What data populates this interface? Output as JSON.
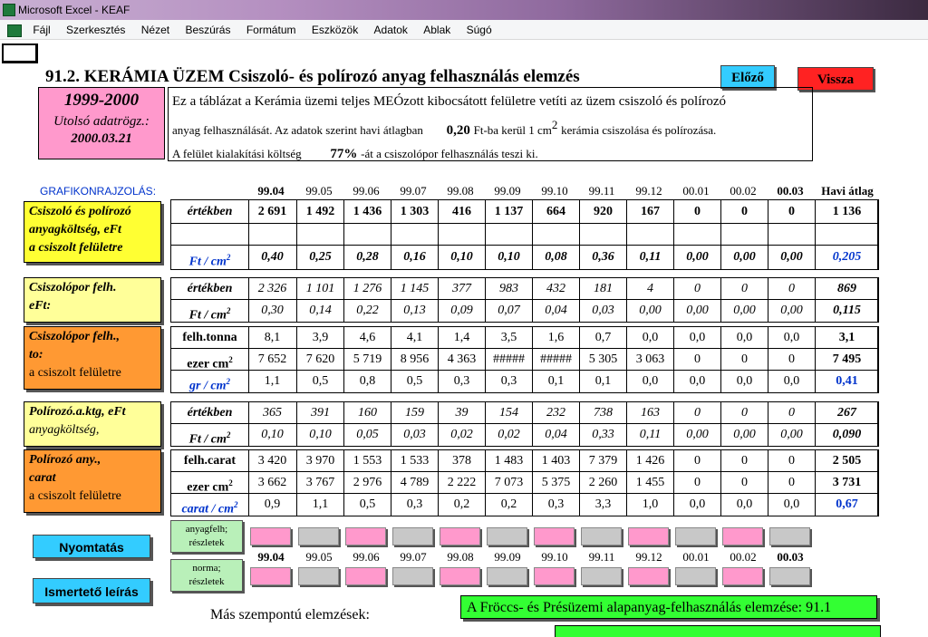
{
  "window": {
    "title": "Microsoft Excel - KEAF"
  },
  "menu": [
    "Fájl",
    "Szerkesztés",
    "Nézet",
    "Beszúrás",
    "Formátum",
    "Eszközök",
    "Adatok",
    "Ablak",
    "Súgó"
  ],
  "sheet": {
    "title": "91.2. KERÁMIA ÜZEM Csiszoló- és polírozó anyag felhasználás elemzés",
    "btn_prev": "Előző",
    "btn_back": "Vissza",
    "period": {
      "years": "1999-2000",
      "label": "Utolsó adatrögz.:",
      "date": "2000.03.21"
    },
    "desc": {
      "line1": "Ez a táblázat a Kerámia üzemi teljes MEÓzott kibocsátott felületre vetíti az üzem csiszoló és polírozó",
      "line2_a": "anyag felhasználását. Az adatok szerint havi átlagban",
      "line2_val": "0,20",
      "line2_b": "Ft-ba kerül 1 cm",
      "line2_sup": "2",
      "line2_c": "kerámia csiszolása és polírozása.",
      "line3_a": "A felület kialakítási költség",
      "line3_val": "77%",
      "line3_b": "-át a csiszolópor felhasználás teszi ki."
    },
    "grafikon": "GRAFIKONRAJZOLÁS:",
    "months": [
      "99.04",
      "99.05",
      "99.06",
      "99.07",
      "99.08",
      "99.09",
      "99.10",
      "99.11",
      "99.12",
      "00.01",
      "00.02",
      "00.03"
    ],
    "avg_header": "Havi átlag",
    "sections": [
      {
        "label_lines": [
          "Csiszoló és polírozó",
          "anyagköltség, eFt",
          "a csiszolt felületre"
        ],
        "rows": [
          {
            "unit": "értékben",
            "vals": [
              "2 691",
              "1 492",
              "1 436",
              "1 303",
              "416",
              "1 137",
              "664",
              "920",
              "167",
              "0",
              "0",
              "0"
            ],
            "avg": "1 136",
            "style": "bd"
          },
          {
            "unit": "",
            "vals": [
              "",
              "",
              "",
              "",
              "",
              "",
              "",
              "",
              "",
              "",
              "",
              ""
            ],
            "avg": "",
            "style": ""
          },
          {
            "unit": "Ft / cm",
            "sup": "2",
            "vals": [
              "0,40",
              "0,25",
              "0,28",
              "0,16",
              "0,10",
              "0,10",
              "0,08",
              "0,36",
              "0,11",
              "0,00",
              "0,00",
              "0,00"
            ],
            "avg": "0,205",
            "style": "bd it",
            "unit_blue": true,
            "avg_blue": true
          }
        ]
      },
      {
        "label_lines": [
          "Csiszolópor felh.",
          "eFt:"
        ],
        "rows": [
          {
            "unit": "értékben",
            "vals": [
              "2 326",
              "1 101",
              "1 276",
              "1 145",
              "377",
              "983",
              "432",
              "181",
              "4",
              "0",
              "0",
              "0"
            ],
            "avg": "869",
            "style": "it"
          },
          {
            "unit": "Ft / cm",
            "sup": "2",
            "vals": [
              "0,30",
              "0,14",
              "0,22",
              "0,13",
              "0,09",
              "0,07",
              "0,04",
              "0,03",
              "0,00",
              "0,00",
              "0,00",
              "0,00"
            ],
            "avg": "0,115",
            "style": "it"
          }
        ]
      },
      {
        "label_lines": [
          "Csiszolópor felh.,",
          "to:",
          "a csiszolt felületre"
        ],
        "rows": [
          {
            "unit": "felh.tonna",
            "vals": [
              "8,1",
              "3,9",
              "4,6",
              "4,1",
              "1,4",
              "3,5",
              "1,6",
              "0,7",
              "0,0",
              "0,0",
              "0,0",
              "0,0"
            ],
            "avg": "3,1",
            "style": ""
          },
          {
            "unit": "ezer cm",
            "sup": "2",
            "vals": [
              "7 652",
              "7 620",
              "5 719",
              "8 956",
              "4 363",
              "#####",
              "#####",
              "5 305",
              "3 063",
              "0",
              "0",
              "0"
            ],
            "avg": "7 495",
            "style": ""
          },
          {
            "unit": "gr / cm",
            "sup": "2",
            "vals": [
              "1,1",
              "0,5",
              "0,8",
              "0,5",
              "0,3",
              "0,3",
              "0,1",
              "0,1",
              "0,0",
              "0,0",
              "0,0",
              "0,0"
            ],
            "avg": "0,41",
            "style": "",
            "unit_blue": true,
            "avg_blue": true
          }
        ]
      },
      {
        "label_lines": [
          "Polírozó.a.ktg, eFt",
          "anyagköltség,"
        ],
        "rows": [
          {
            "unit": "értékben",
            "vals": [
              "365",
              "391",
              "160",
              "159",
              "39",
              "154",
              "232",
              "738",
              "163",
              "0",
              "0",
              "0"
            ],
            "avg": "267",
            "style": "it"
          },
          {
            "unit": "Ft / cm",
            "sup": "2",
            "vals": [
              "0,10",
              "0,10",
              "0,05",
              "0,03",
              "0,02",
              "0,02",
              "0,04",
              "0,33",
              "0,11",
              "0,00",
              "0,00",
              "0,00"
            ],
            "avg": "0,090",
            "style": "it"
          }
        ]
      },
      {
        "label_lines": [
          "Polírozó any.,",
          "carat",
          "a csiszolt felületre"
        ],
        "rows": [
          {
            "unit": "felh.carat",
            "vals": [
              "3 420",
              "3 970",
              "1 553",
              "1 533",
              "378",
              "1 483",
              "1 403",
              "7 379",
              "1 426",
              "0",
              "0",
              "0"
            ],
            "avg": "2 505",
            "style": ""
          },
          {
            "unit": "ezer cm",
            "sup": "2",
            "vals": [
              "3 662",
              "3 767",
              "2 976",
              "4 789",
              "2 222",
              "7 073",
              "5 375",
              "2 260",
              "1 455",
              "0",
              "0",
              "0"
            ],
            "avg": "3 731",
            "style": ""
          },
          {
            "unit": "carat / cm",
            "sup": "2",
            "vals": [
              "0,9",
              "1,1",
              "0,5",
              "0,3",
              "0,2",
              "0,2",
              "0,3",
              "3,3",
              "1,0",
              "0,0",
              "0,0",
              "0,0"
            ],
            "avg": "0,67",
            "style": "",
            "unit_blue": true,
            "avg_blue": true
          }
        ]
      }
    ],
    "btn_anyag": [
      "anyagfelh;",
      "részletek"
    ],
    "btn_norma": [
      "norma;",
      "részletek"
    ],
    "btn_print": "Nyomtatás",
    "btn_desc": "Ismertető leírás",
    "other_label": "Más szempontú elemzések:",
    "link_911": "A Fröccs- és Présüzemi alapanyag-felhasználás elemzése: 91.1"
  }
}
